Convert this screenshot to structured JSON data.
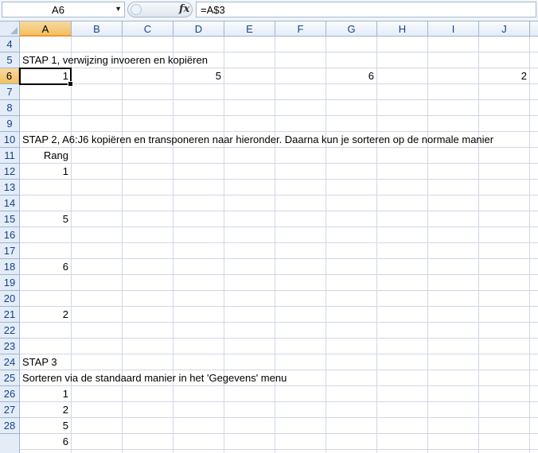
{
  "name_box": "A6",
  "formula": "=A$3",
  "columns": [
    "A",
    "B",
    "C",
    "D",
    "E",
    "F",
    "G",
    "H",
    "I",
    "J"
  ],
  "rows": [
    "4",
    "5",
    "6",
    "7",
    "8",
    "9",
    "10",
    "11",
    "12",
    "13",
    "14",
    "15",
    "16",
    "17",
    "18",
    "19",
    "20",
    "21",
    "22",
    "23",
    "24",
    "25",
    "26",
    "27",
    "28"
  ],
  "cells": {
    "r5_A": "STAP 1, verwijzing invoeren en kopiëren",
    "r6_A": "1",
    "r6_D": "5",
    "r6_G": "6",
    "r6_J": "2",
    "r9_A": "STAP 2, A6:J6 kopiëren en transponeren naar hieronder. Daarna kun je sorteren op de normale manier",
    "r10_A": "Rang",
    "r11_A": "1",
    "r14_A": "5",
    "r17_A": "6",
    "r20_A": "2",
    "r23_A": "STAP 3",
    "r24_A": "Sorteren via de standaard manier in het 'Gegevens' menu",
    "r25_A": "1",
    "r26_A": "2",
    "r27_A": "5",
    "r28_A": "6"
  }
}
